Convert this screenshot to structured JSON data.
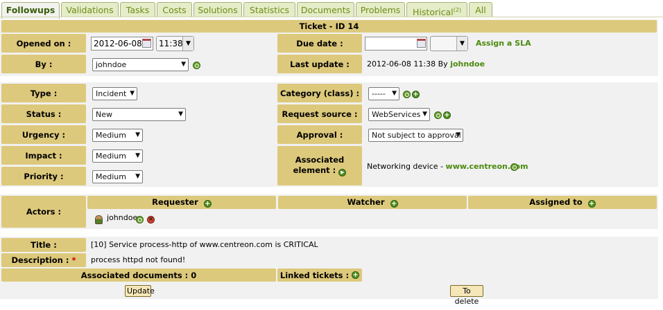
{
  "tabs": [
    {
      "label": "Followups",
      "active": true
    },
    {
      "label": "Validations"
    },
    {
      "label": "Tasks"
    },
    {
      "label": "Costs"
    },
    {
      "label": "Solutions"
    },
    {
      "label": "Statistics"
    },
    {
      "label": "Documents"
    },
    {
      "label": "Problems"
    },
    {
      "label": "Historical",
      "badge": "(2)"
    },
    {
      "label": "All"
    }
  ],
  "ticket": {
    "title": "Ticket - ID 14",
    "opened_on_label": "Opened on :",
    "opened_date": "2012-06-08",
    "opened_time": "11:38",
    "due_date_label": "Due date :",
    "due_date_value": "",
    "due_time_value": "",
    "assign_sla": "Assign a SLA",
    "by_label": "By :",
    "by_value": "johndoe",
    "last_update_label": "Last update :",
    "last_update_value": "2012-06-08 11:38 By",
    "last_update_user": "johndoe"
  },
  "details": {
    "type_label": "Type :",
    "type_value": "Incident",
    "status_label": "Status :",
    "status_value": "New",
    "urgency_label": "Urgency :",
    "urgency_value": "Medium",
    "impact_label": "Impact :",
    "impact_value": "Medium",
    "priority_label": "Priority :",
    "priority_value": "Medium",
    "category_label": "Category (class) :",
    "category_value": "-----",
    "source_label": "Request source :",
    "source_value": "WebServices",
    "approval_label": "Approval :",
    "approval_value": "Not subject to approval",
    "assoc_label_1": "Associated",
    "assoc_label_2": "element :",
    "assoc_prefix": "Networking device -",
    "assoc_link": "www.centreon.com"
  },
  "actors": {
    "label": "Actors :",
    "requester_header": "Requester",
    "watcher_header": "Watcher",
    "assigned_header": "Assigned to",
    "requester_user": "johndoe"
  },
  "content": {
    "title_label": "Title :",
    "title_value": "[10] Service process-http of www.centreon.com is CRITICAL",
    "description_label": "Description :",
    "description_required": "*",
    "description_value": "process httpd not found!",
    "documents_label": "Associated documents : 0",
    "linked_label": "Linked tickets :"
  },
  "buttons": {
    "update": "Update",
    "delete": "To delete"
  }
}
